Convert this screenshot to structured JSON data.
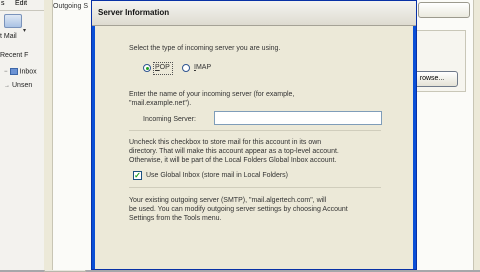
{
  "outlook": {
    "menu": [
      "s",
      "Edit"
    ],
    "toolbar": {
      "get_mail_label": "t Mail",
      "dropdown_arrow": "▾"
    },
    "recent_label": "Recent F",
    "folders": [
      "Inbox",
      "Unsen"
    ],
    "outgoing_label": "Outgoing S",
    "browse_label": "rowse..."
  },
  "dialog": {
    "title": "Server Information",
    "server_type_prompt": "Select the type of incoming server you are using.",
    "server_types": [
      {
        "label": "POP",
        "selected": true
      },
      {
        "label": "IMAP",
        "selected": false
      }
    ],
    "name_prompt_line1": "Enter the name of your incoming server (for example,",
    "name_prompt_line2": "\"mail.example.net\").",
    "incoming_server_label": "Incoming Server:",
    "incoming_server_value": "",
    "inbox_note_line1": "Uncheck this checkbox to store mail for this account in its own",
    "inbox_note_line2": "directory. That will make this account appear as a top-level account.",
    "inbox_note_line3": "Otherwise, it will be part of the Local Folders Global Inbox account.",
    "global_inbox_label": "Use Global Inbox (store mail in Local Folders)",
    "global_inbox_checked": true,
    "smtp_note_line1": "Your existing outgoing server (SMTP), \"mail.algertech.com\", will",
    "smtp_note_line2": "be used. You can modify outgoing server settings by choosing Account",
    "smtp_note_line3": "Settings from the Tools menu."
  },
  "colors": {
    "dialog_frame": "#0a4fd6",
    "dialog_body": "#ece9d8",
    "radio_dot": "#21a121"
  }
}
